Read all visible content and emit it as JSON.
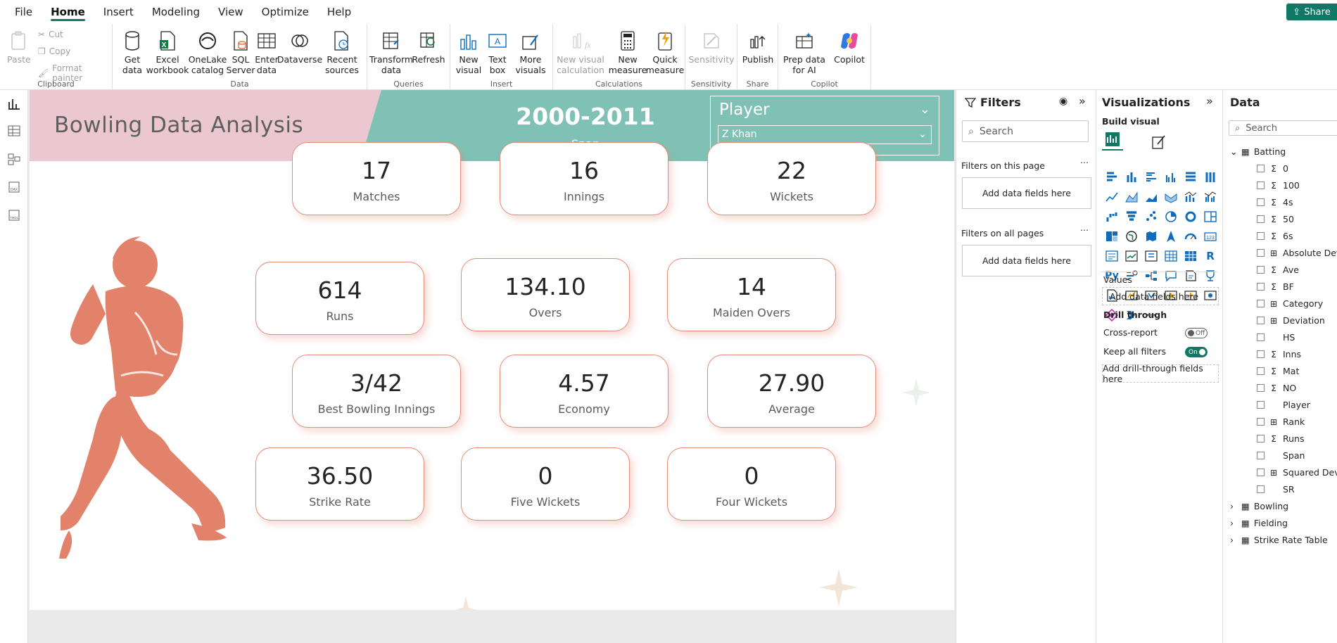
{
  "menu": [
    "File",
    "Home",
    "Insert",
    "Modeling",
    "View",
    "Optimize",
    "Help"
  ],
  "share_label": "Share",
  "ribbon": {
    "clipboard": {
      "paste": "Paste",
      "cut": "Cut",
      "copy": "Copy",
      "format_painter": "Format painter",
      "label": "Clipboard"
    },
    "data": {
      "get_data": "Get data",
      "excel": "Excel workbook",
      "onelake": "OneLake catalog",
      "sql": "SQL Server",
      "enter": "Enter data",
      "dataverse": "Dataverse",
      "recent": "Recent sources",
      "label": "Data"
    },
    "queries": {
      "transform": "Transform data",
      "refresh": "Refresh",
      "label": "Queries"
    },
    "insert": {
      "new_visual": "New visual",
      "text_box": "Text box",
      "more_visuals": "More visuals",
      "label": "Insert"
    },
    "calculations": {
      "new_visual_calc": "New visual calculation",
      "new_measure": "New measure",
      "quick_measure": "Quick measure",
      "label": "Calculations"
    },
    "sensitivity": {
      "btn": "Sensitivity",
      "label": "Sensitivity"
    },
    "share": {
      "publish": "Publish",
      "label": "Share"
    },
    "copilot": {
      "prep": "Prep data for AI",
      "copilot": "Copilot",
      "label": "Copilot"
    }
  },
  "report": {
    "title": "Bowling Data Analysis",
    "span_value": "2000-2011",
    "span_label": "Span",
    "slicer_title": "Player",
    "slicer_value": "Z Khan"
  },
  "cards": [
    {
      "value": "17",
      "label": "Matches"
    },
    {
      "value": "16",
      "label": "Innings"
    },
    {
      "value": "22",
      "label": "Wickets"
    },
    {
      "value": "614",
      "label": "Runs"
    },
    {
      "value": "134.10",
      "label": "Overs"
    },
    {
      "value": "14",
      "label": "Maiden Overs"
    },
    {
      "value": "3/42",
      "label": "Best Bowling Innings"
    },
    {
      "value": "4.57",
      "label": "Economy"
    },
    {
      "value": "27.90",
      "label": "Average"
    },
    {
      "value": "36.50",
      "label": "Strike Rate"
    },
    {
      "value": "0",
      "label": "Five Wickets"
    },
    {
      "value": "0",
      "label": "Four Wickets"
    }
  ],
  "filters": {
    "title": "Filters",
    "search": "Search",
    "on_page": "Filters on this page",
    "on_all": "Filters on all pages",
    "add": "Add data fields here"
  },
  "viz": {
    "title": "Visualizations",
    "build": "Build visual",
    "values": "Values",
    "add_values": "Add data fields here",
    "drill": "Drill through",
    "cross_report": "Cross-report",
    "cross_state": "Off",
    "keep_filters": "Keep all filters",
    "keep_state": "On",
    "add_drill": "Add drill-through fields here"
  },
  "data_pane": {
    "title": "Data",
    "search": "Search",
    "tables": [
      {
        "name": "Batting",
        "expanded": true
      },
      {
        "name": "Bowling",
        "expanded": false
      },
      {
        "name": "Fielding",
        "expanded": false
      },
      {
        "name": "Strike Rate Table",
        "expanded": false
      }
    ],
    "batting_fields": [
      {
        "type": "Σ",
        "name": "0"
      },
      {
        "type": "Σ",
        "name": "100"
      },
      {
        "type": "Σ",
        "name": "4s"
      },
      {
        "type": "Σ",
        "name": "50"
      },
      {
        "type": "Σ",
        "name": "6s"
      },
      {
        "type": "calc",
        "name": "Absolute Deviati"
      },
      {
        "type": "Σ",
        "name": "Ave"
      },
      {
        "type": "Σ",
        "name": "BF"
      },
      {
        "type": "calc",
        "name": "Category"
      },
      {
        "type": "calc",
        "name": "Deviation"
      },
      {
        "type": "",
        "name": "HS"
      },
      {
        "type": "Σ",
        "name": "Inns"
      },
      {
        "type": "Σ",
        "name": "Mat"
      },
      {
        "type": "Σ",
        "name": "NO"
      },
      {
        "type": "",
        "name": "Player"
      },
      {
        "type": "calc",
        "name": "Rank"
      },
      {
        "type": "Σ",
        "name": "Runs"
      },
      {
        "type": "",
        "name": "Span"
      },
      {
        "type": "calc",
        "name": "Squared Deviati"
      },
      {
        "type": "",
        "name": "SR"
      }
    ]
  },
  "colors": {
    "accent": "#117865",
    "header_pink": "#ebc8d1",
    "header_teal": "#7fc2b5",
    "card_border": "#e58a77",
    "figure": "#e2826b"
  }
}
